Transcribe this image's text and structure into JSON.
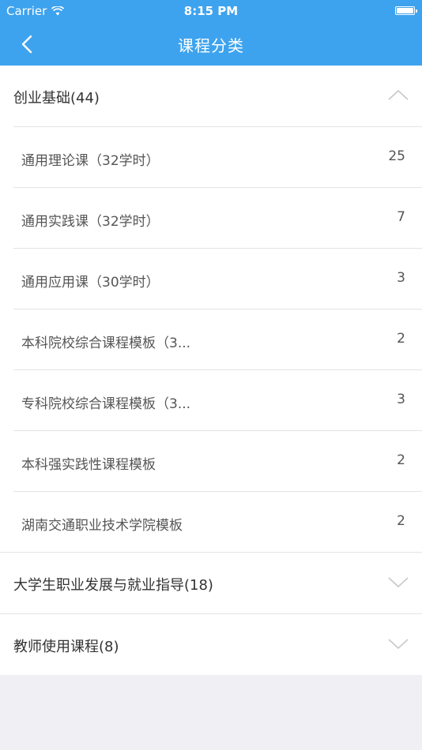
{
  "status_bar": {
    "carrier": "Carrier",
    "time": "8:15 PM"
  },
  "nav": {
    "title": "课程分类"
  },
  "categories": [
    {
      "label": "创业基础(44)",
      "expanded": true,
      "children": [
        {
          "label": "通用理论课（32学时）",
          "count": "25"
        },
        {
          "label": "通用实践课（32学时）",
          "count": "7"
        },
        {
          "label": "通用应用课（30学时）",
          "count": "3"
        },
        {
          "label": "本科院校综合课程模板（3...",
          "count": "2"
        },
        {
          "label": "专科院校综合课程模板（3...",
          "count": "3"
        },
        {
          "label": "本科强实践性课程模板",
          "count": "2"
        },
        {
          "label": "湖南交通职业技术学院模板",
          "count": "2"
        }
      ]
    },
    {
      "label": "大学生职业发展与就业指导(18)",
      "expanded": false
    },
    {
      "label": "教师使用课程(8)",
      "expanded": false
    }
  ],
  "colors": {
    "header": "#3ea3ee",
    "background": "#efeff4",
    "divider": "#e3e3e3",
    "chevron": "#c7c7cc"
  }
}
